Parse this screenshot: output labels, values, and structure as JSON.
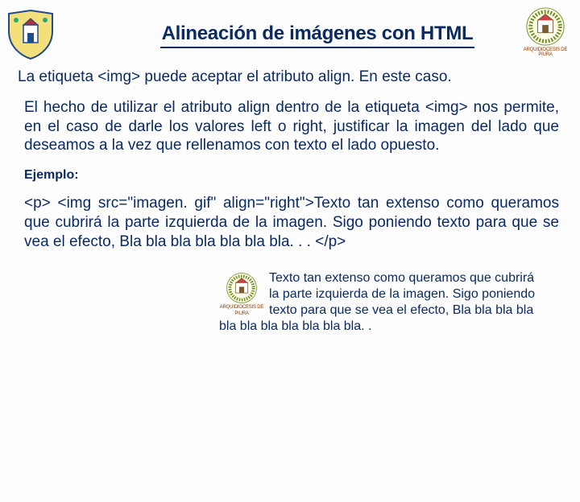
{
  "header": {
    "title": "Alineación de imágenes con HTML"
  },
  "body": {
    "intro": "La etiqueta <img> puede aceptar el atributo align. En este caso.",
    "explain": "El hecho de utilizar el atributo align dentro de la etiqueta <img> nos permite, en el caso de darle los valores left o right, justificar la imagen del lado que deseamos a la vez que rellenamos con texto el lado opuesto.",
    "example_label": "Ejemplo:",
    "example_code": "<p>  <img  src=\"imagen. gif\"  align=\"right\">Texto  tan extenso como queramos que cubrirá la parte izquierda de la imagen. Sigo poniendo texto para que se vea el efecto, Bla bla bla bla bla bla bla. . . </p>",
    "demo_text": "Texto tan extenso como queramos que cubrirá la parte izquierda de la imagen. Sigo poniendo texto para que se vea el efecto, Bla bla bla bla bla bla bla bla bla bla bla. ."
  },
  "icons": {
    "crest_left": "university-shield-icon",
    "crest_right": "archdiocese-crest-icon",
    "crest_right_caption": "ARQUIDIOCESIS DE PIURA",
    "demo_crest": "archdiocese-crest-icon",
    "demo_crest_caption": "ARQUIDIOCESIS DE PIURA"
  }
}
